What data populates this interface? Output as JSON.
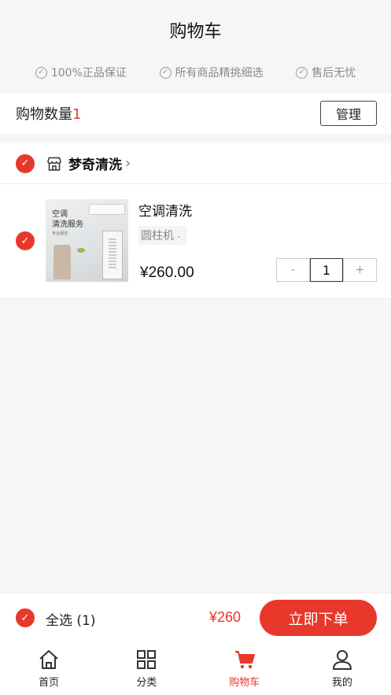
{
  "header": {
    "title": "购物车"
  },
  "guarantees": [
    "100%正品保证",
    "所有商品精挑细选",
    "售后无忧"
  ],
  "cart": {
    "count_label": "购物数量",
    "count": "1",
    "manage_label": "管理"
  },
  "store": {
    "name": "梦奇清洗"
  },
  "item": {
    "thumb_line1": "空调",
    "thumb_line2": "清洗服务",
    "thumb_line3": "专业保洁",
    "name": "空调清洗",
    "spec": "圆柱机",
    "price": "¥260.00",
    "quantity": "1",
    "minus": "-",
    "plus": "+"
  },
  "checkout": {
    "select_all": "全选 (1)",
    "total": "¥260",
    "order_label": "立即下单"
  },
  "tabs": [
    {
      "label": "首页",
      "icon": "home-icon"
    },
    {
      "label": "分类",
      "icon": "grid-icon"
    },
    {
      "label": "购物车",
      "icon": "cart-icon"
    },
    {
      "label": "我的",
      "icon": "user-icon"
    }
  ],
  "colors": {
    "accent": "#e8382c",
    "background": "#f5f6f8"
  }
}
